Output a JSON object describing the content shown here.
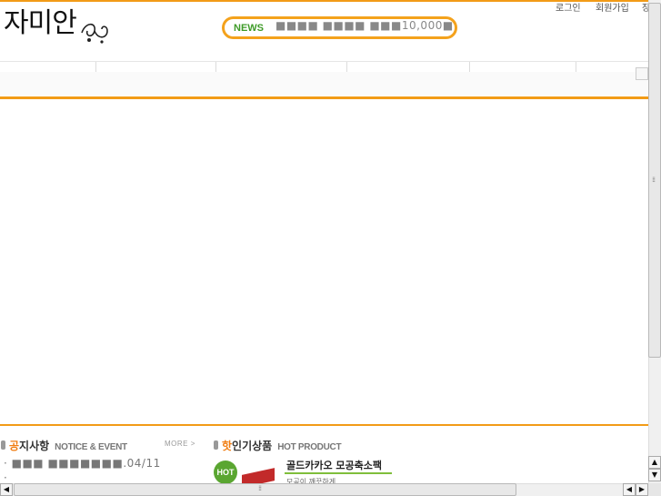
{
  "header": {
    "logo_text": "자미안",
    "news_label": "NEWS",
    "news_text": "■■■■ ■■■■ ■■■10,000■ ■..",
    "top_links": [
      "로그인",
      "회원가입",
      "장"
    ]
  },
  "notice": {
    "title_highlight": "공",
    "title_rest": "지사항",
    "title_en": "NOTICE & EVENT",
    "more_label": "MORE >",
    "items": [
      "· ■■■ ■■■■■■■.04/11",
      "·"
    ]
  },
  "hot_product": {
    "title_highlight": "핫",
    "title_rest": "인기상품",
    "title_en": "HOT PRODUCT",
    "badge": "HOT",
    "product_name": "골드카카오 모공축소팩",
    "product_sub": "모공이 깨끗하게"
  },
  "scrollbars": {
    "up_arrow": "▲",
    "down_arrow": "▼",
    "left_arrow": "◀",
    "right_arrow": "▶",
    "grip": "⁞⁞"
  }
}
